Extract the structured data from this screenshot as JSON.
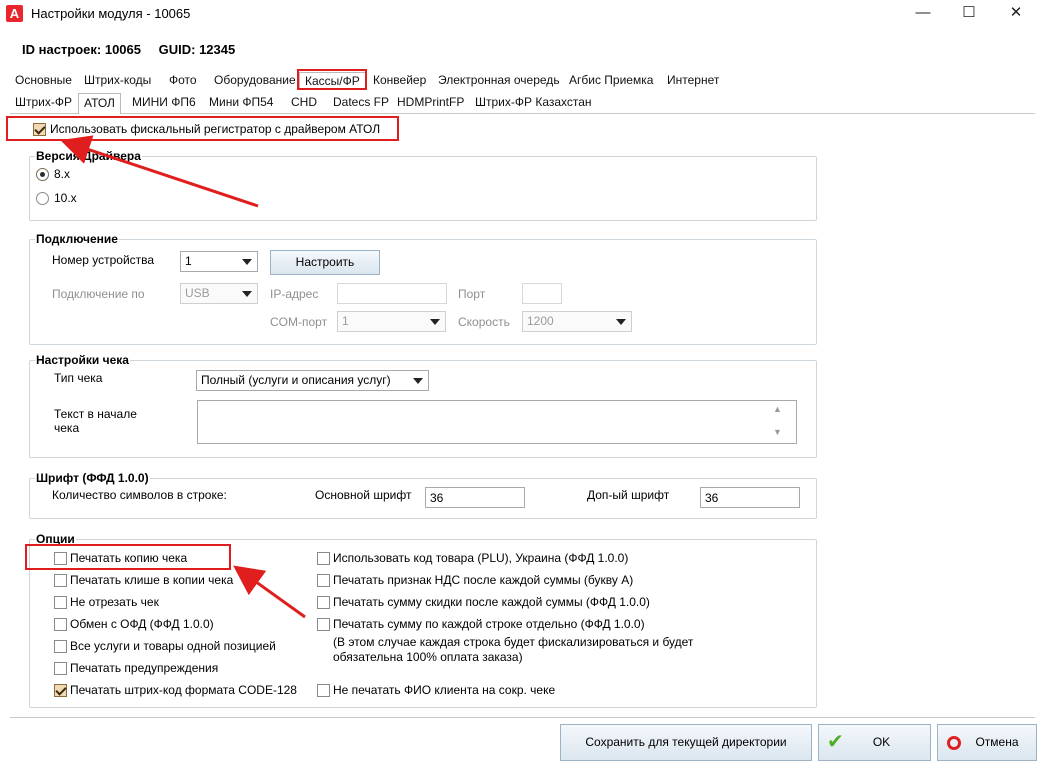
{
  "window": {
    "title": "Настройки модуля  - 10065",
    "app_icon_letter": "A",
    "minimize": "—",
    "maximize": "☐",
    "close": "✕"
  },
  "header": {
    "id_label": "ID настроек: 10065",
    "guid_label": "GUID: 12345"
  },
  "tabs_main": [
    "Основные",
    "Штрих-коды",
    "Фото",
    "Оборудование",
    "Кассы/ФР",
    "Конвейер",
    "Электронная очередь",
    "Агбис Приемка",
    "Интернет"
  ],
  "tabs_sub": [
    "Штрих-ФР",
    "АТОЛ",
    "МИНИ ФП6",
    "Мини ФП54",
    "CHD",
    "Datecs FP",
    "HDMPrintFP",
    "Штрих-ФР Казахстан"
  ],
  "use_fiscal": {
    "label": "Использовать фискальный регистратор с драйвером АТОЛ",
    "checked": true
  },
  "driver_version": {
    "title": "Версия Драйвера",
    "options": [
      "8.x",
      "10.x"
    ],
    "selected": "8.x"
  },
  "connection": {
    "title": "Подключение",
    "device_number_label": "Номер устройства",
    "device_number_value": "1",
    "configure_button": "Настроить",
    "connect_by_label": "Подключение по",
    "connect_by_value": "USB",
    "ip_label": "IP-адрес",
    "ip_value": "",
    "port_label": "Порт",
    "port_value": "",
    "com_label": "COM-порт",
    "com_value": "1",
    "speed_label": "Скорость",
    "speed_value": "1200"
  },
  "receipt": {
    "title": "Настройки чека",
    "type_label": "Тип чека",
    "type_value": "Полный (услуги и описания услуг)",
    "header_text_label_1": "Текст в начале",
    "header_text_label_2": "чека",
    "header_text_value": ""
  },
  "font": {
    "title": "Шрифт (ФФД 1.0.0)",
    "chars_label": "Количество символов в строке:",
    "main_label": "Основной шрифт",
    "main_value": "36",
    "extra_label": "Доп-ый шрифт",
    "extra_value": "36"
  },
  "options": {
    "title": "Опции",
    "left": [
      {
        "label": "Печатать копию чека",
        "checked": false
      },
      {
        "label": "Печатать клише в копии чека",
        "checked": false
      },
      {
        "label": "Не отрезать чек",
        "checked": false
      },
      {
        "label": "Обмен с ОФД (ФФД 1.0.0)",
        "checked": false
      },
      {
        "label": "Все услуги и товары одной позицией",
        "checked": false
      },
      {
        "label": "Печатать предупреждения",
        "checked": false
      },
      {
        "label": "Печатать штрих-код формата CODE-128",
        "checked": true
      }
    ],
    "right": [
      {
        "label": "Использовать код товара (PLU), Украина (ФФД 1.0.0)",
        "checked": false
      },
      {
        "label": "Печатать признак НДС после каждой суммы (букву А)",
        "checked": false
      },
      {
        "label": "Печатать сумму скидки после каждой суммы (ФФД 1.0.0)",
        "checked": false
      },
      {
        "label": "Печатать сумму по каждой строке отдельно (ФФД 1.0.0)",
        "checked": false
      },
      {
        "label": "Не печатать ФИО клиента на сокр. чеке",
        "checked": false
      }
    ],
    "note_line1": "(В этом случае каждая строка будет фискализироваться и будет",
    "note_line2": "обязательна 100% оплата заказа)"
  },
  "footer": {
    "save_dir": "Сохранить для текущей директории",
    "ok": "OK",
    "cancel": "Отмена"
  },
  "colors": {
    "annotation_red": "#e01e1e",
    "checked_fill": "#f1d9b5"
  }
}
